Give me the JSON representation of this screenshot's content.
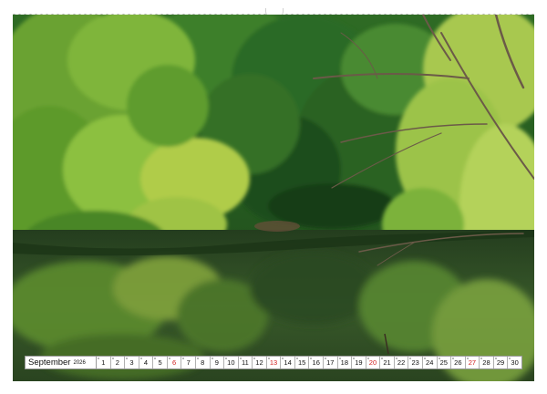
{
  "calendar": {
    "month": "September",
    "year": "2026",
    "days": [
      "1",
      "2",
      "3",
      "4",
      "5",
      "6",
      "7",
      "8",
      "9",
      "10",
      "11",
      "12",
      "13",
      "14",
      "15",
      "16",
      "17",
      "18",
      "19",
      "20",
      "21",
      "22",
      "23",
      "24",
      "25",
      "26",
      "27",
      "28",
      "29",
      "30"
    ],
    "sundays": [
      "6",
      "13",
      "20",
      "27"
    ],
    "sunday_color": "#d12020"
  },
  "photo": {
    "subject": "forest-river-reflection",
    "colors": {
      "foliage_light": "#a6c93a",
      "foliage_mid": "#4f8f2a",
      "foliage_dark": "#1f4a1c",
      "water": "#2f4a26",
      "branch": "#6b5a48"
    }
  }
}
